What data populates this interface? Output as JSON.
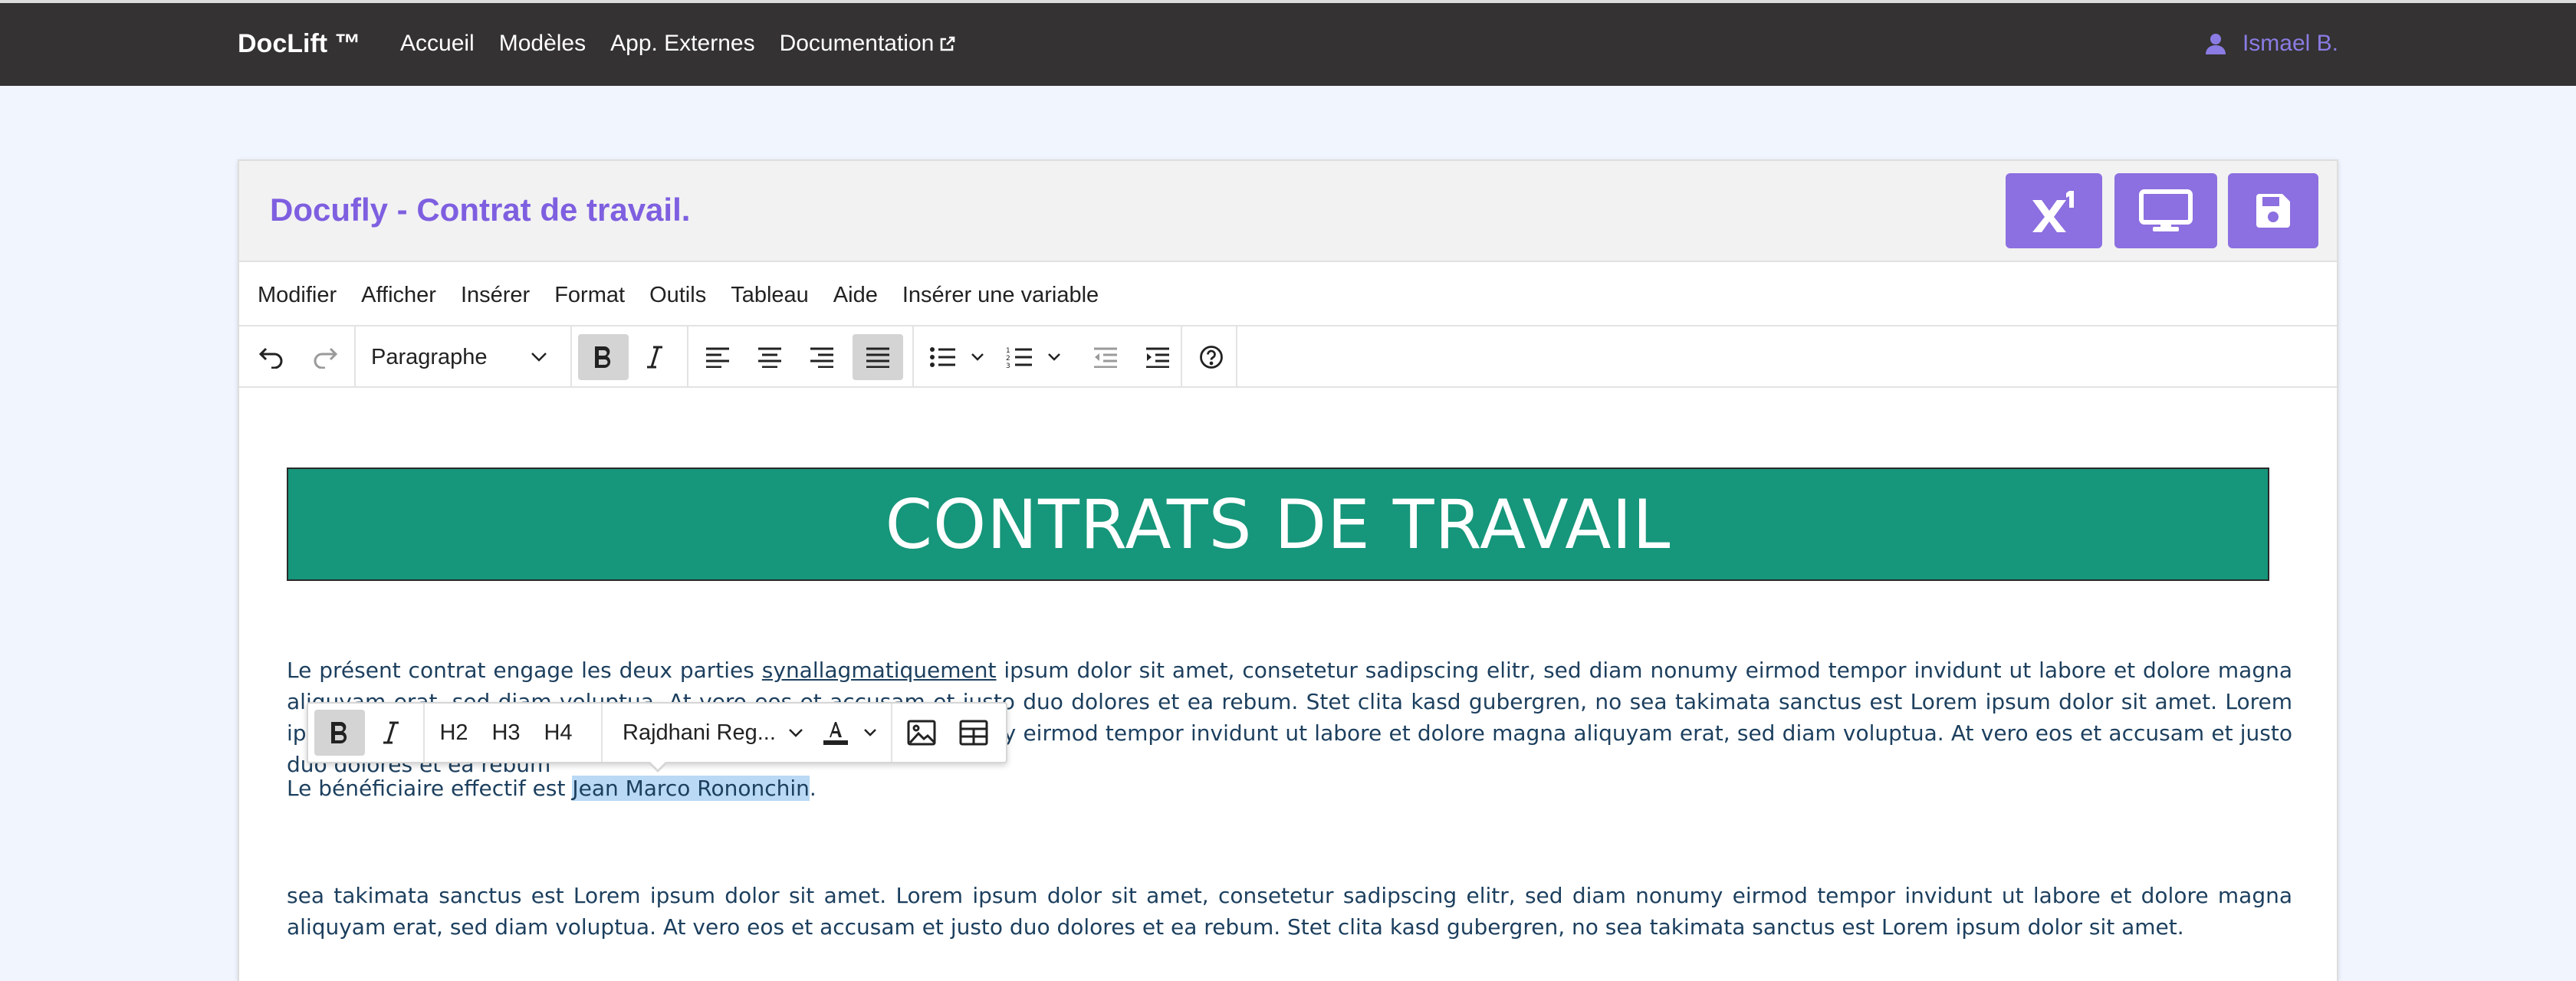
{
  "navbar": {
    "brand": "DocLift ™",
    "links": [
      "Accueil",
      "Modèles",
      "App. Externes",
      "Documentation"
    ],
    "user": "Ismael B."
  },
  "editor": {
    "title": "Docufly - Contrat de travail.",
    "menu": [
      "Modifier",
      "Afficher",
      "Insérer",
      "Format",
      "Outils",
      "Tableau",
      "Aide",
      "Insérer une variable"
    ],
    "block_format": "Paragraphe"
  },
  "floating_toolbar": {
    "headings": [
      "H2",
      "H3",
      "H4"
    ],
    "font": "Rajdhani Reg..."
  },
  "document": {
    "banner": "CONTRATS DE TRAVAIL",
    "p1_a": "Le présent contrat engage les deux parties ",
    "p1_link": "synallagmatiquement",
    "p1_b": " ipsum dolor sit amet, consetetur sadipscing elitr, sed diam nonumy eirmod tempor invidunt ut labore et dolore magna aliquyam erat, sed diam voluptua. At vero eos et accusam et justo duo dolores et ea rebum. Stet clita kasd gubergren, no sea takimata sanctus est Lorem ipsum dolor sit amet. Lorem ipsum dolor sit amet, consetetur sadipscing elitr, sed diam nonumy eirmod tempor invidunt ut labore et dolore magna aliquyam erat, sed diam voluptua. At vero eos et accusam et justo duo dolores et ea rebum",
    "p2_a": "Le bénéficiaire effectif est ",
    "p2_name": "Jean Marco Rononchin",
    "p2_b": ".",
    "p3": "sea takimata sanctus est Lorem ipsum dolor sit amet. Lorem ipsum dolor sit amet, consetetur sadipscing elitr, sed diam nonumy eirmod tempor invidunt ut labore et dolore magna aliquyam erat, sed diam voluptua. At vero eos et accusam et justo duo dolores et ea rebum. Stet clita kasd gubergren, no sea takimata sanctus est Lorem ipsum dolor sit amet."
  },
  "colors": {
    "navbar_bg": "#343232",
    "accent": "#8c6fe0",
    "banner_bg": "#16967a",
    "text": "#1c3f5e",
    "selection": "#b9d9f4"
  }
}
